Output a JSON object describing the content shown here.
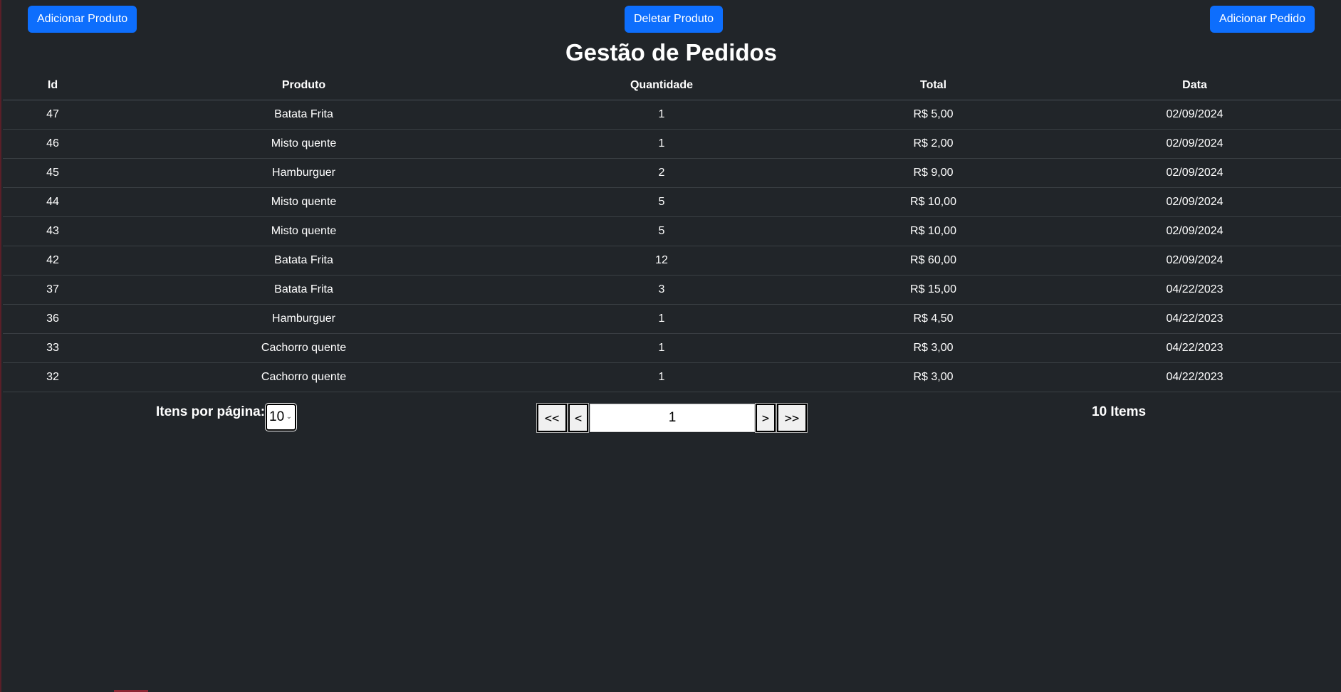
{
  "toolbar": {
    "add_product_label": "Adicionar Produto",
    "delete_product_label": "Deletar Produto",
    "add_order_label": "Adicionar Pedido",
    "button_color": "#0d6efd"
  },
  "page": {
    "title": "Gestão de Pedidos",
    "background": "#212529"
  },
  "table": {
    "headers": [
      "Id",
      "Produto",
      "Quantidade",
      "Total",
      "Data"
    ],
    "rows": [
      [
        "47",
        "Batata Frita",
        "1",
        "R$ 5,00",
        "02/09/2024"
      ],
      [
        "46",
        "Misto quente",
        "1",
        "R$ 2,00",
        "02/09/2024"
      ],
      [
        "45",
        "Hamburguer",
        "2",
        "R$ 9,00",
        "02/09/2024"
      ],
      [
        "44",
        "Misto quente",
        "5",
        "R$ 10,00",
        "02/09/2024"
      ],
      [
        "43",
        "Misto quente",
        "5",
        "R$ 10,00",
        "02/09/2024"
      ],
      [
        "42",
        "Batata Frita",
        "12",
        "R$ 60,00",
        "02/09/2024"
      ],
      [
        "37",
        "Batata Frita",
        "3",
        "R$ 15,00",
        "04/22/2023"
      ],
      [
        "36",
        "Hamburguer",
        "1",
        "R$ 4,50",
        "04/22/2023"
      ],
      [
        "33",
        "Cachorro quente",
        "1",
        "R$ 3,00",
        "04/22/2023"
      ],
      [
        "32",
        "Cachorro quente",
        "1",
        "R$ 3,00",
        "04/22/2023"
      ]
    ]
  },
  "pagination": {
    "per_page_label": "Itens por página:",
    "per_page_value": "10",
    "first_label": "<<",
    "prev_label": "<",
    "current_page": "1",
    "next_label": ">",
    "last_label": ">>",
    "items_count": "10 Items"
  },
  "icons": {
    "select_chevron": "chevron-down-icon"
  }
}
